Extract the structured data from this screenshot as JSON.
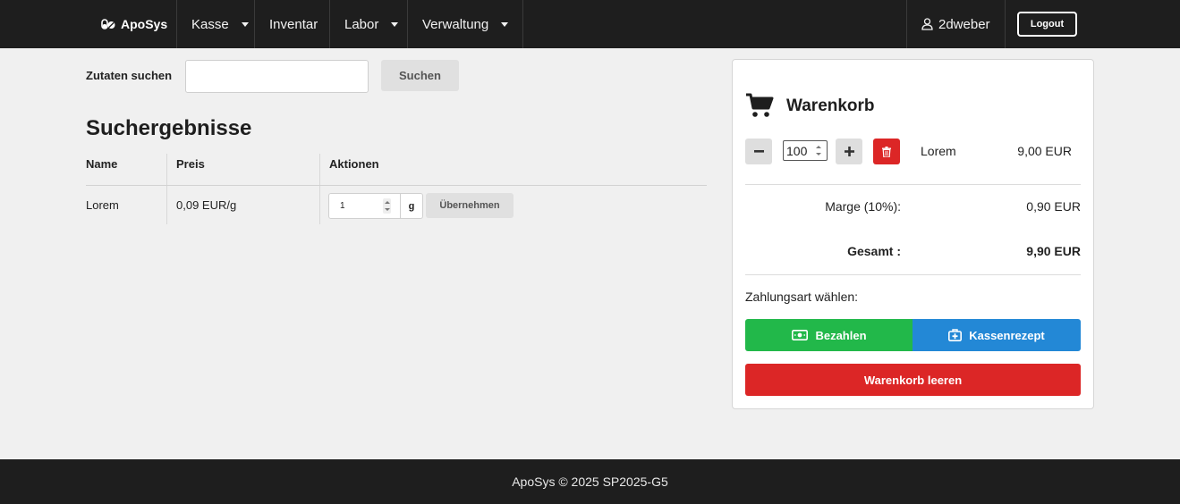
{
  "navbar": {
    "brand": "ApoSys",
    "items": [
      {
        "label": "Kasse",
        "dropdown": true
      },
      {
        "label": "Inventar",
        "dropdown": false
      },
      {
        "label": "Labor",
        "dropdown": true
      },
      {
        "label": "Verwaltung",
        "dropdown": true
      }
    ],
    "user": "2dweber",
    "logout": "Logout"
  },
  "search": {
    "label": "Zutaten suchen",
    "value": "",
    "button": "Suchen"
  },
  "results": {
    "title": "Suchergebnisse",
    "columns": [
      "Name",
      "Preis",
      "Aktionen"
    ],
    "rows": [
      {
        "name": "Lorem",
        "price": "0,09 EUR/g",
        "quantity": "1",
        "unit": "g",
        "action": "Übernehmen"
      }
    ]
  },
  "cart": {
    "title": "Warenkorb",
    "items": [
      {
        "quantity": "100",
        "name": "Lorem",
        "price": "9,00 EUR"
      }
    ],
    "margin_label": "Marge (10%):",
    "margin_value": "0,90 EUR",
    "total_label": "Gesamt :",
    "total_value": "9,90 EUR",
    "payment_label": "Zahlungsart wählen:",
    "pay_button": "Bezahlen",
    "prescription_button": "Kassenrezept",
    "clear_button": "Warenkorb leeren"
  },
  "footer": {
    "text": "ApoSys © 2025 SP2025-G5"
  },
  "colors": {
    "navbar_bg": "#1e1e1e",
    "success": "#22b84a",
    "info": "#2388d6",
    "danger": "#dc2626"
  }
}
